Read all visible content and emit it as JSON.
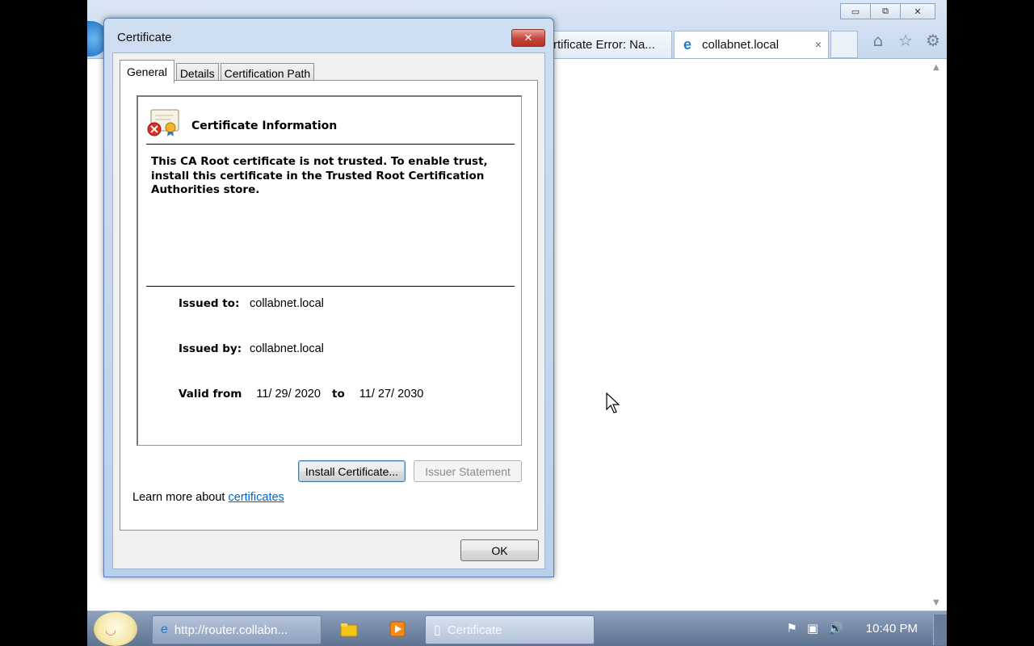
{
  "browser": {
    "tabs": [
      {
        "label": "rtificate Error: Na..."
      },
      {
        "label": "collabnet.local",
        "close_icon": "×"
      }
    ],
    "window_controls": {
      "minimize": "▭",
      "restore": "⧉",
      "close": "✕"
    },
    "toolbar_icons": {
      "home": "⌂",
      "favorites": "☆",
      "tools": "⚙"
    }
  },
  "dialog": {
    "title": "Certificate",
    "close_glyph": "✕",
    "tabs": [
      {
        "label": "General"
      },
      {
        "label": "Details"
      },
      {
        "label": "Certification Path"
      }
    ],
    "info_title": "Certificate Information",
    "warning_text": "This CA Root certificate is not trusted. To enable trust, install this certificate in the Trusted Root Certification Authorities store.",
    "issued_to_label": "Issued to:",
    "issued_to_value": "collabnet.local",
    "issued_by_label": "Issued by:",
    "issued_by_value": "collabnet.local",
    "valid_from_label": "Valid from",
    "valid_from_value": "11/ 29/ 2020",
    "valid_to_label": "to",
    "valid_to_value": "11/ 27/ 2030",
    "install_button": "Install Certificate...",
    "issuer_button": "Issuer Statement",
    "learn_more_prefix": "Learn more about ",
    "learn_more_link": "certificates",
    "ok_button": "OK"
  },
  "taskbar": {
    "buttons": [
      {
        "label": "http://router.collabn..."
      },
      {
        "label": "Certificate"
      }
    ],
    "clock": "10:40 PM"
  },
  "colors": {
    "link": "#0066cc",
    "dialog_frame": "#b9d0ec",
    "close_button": "#c2453a"
  }
}
